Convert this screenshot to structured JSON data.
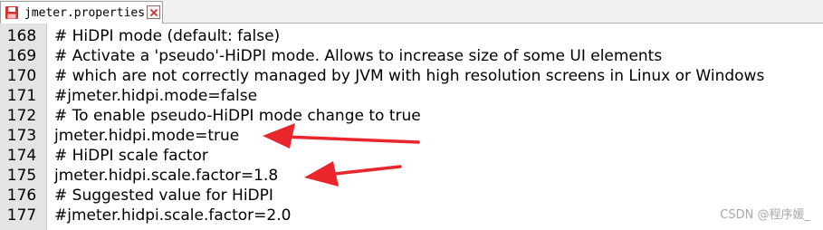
{
  "tab": {
    "title": "jmeter.properties",
    "icon": "save-file-icon",
    "close_icon": "close-icon"
  },
  "lines": [
    {
      "number": "168",
      "text": "# HiDPI mode (default: false)"
    },
    {
      "number": "169",
      "text": "# Activate a 'pseudo'-HiDPI mode. Allows to increase size of some UI elements"
    },
    {
      "number": "170",
      "text": "# which are not correctly managed by JVM with high resolution screens in Linux or Windows"
    },
    {
      "number": "171",
      "text": "#jmeter.hidpi.mode=false"
    },
    {
      "number": "172",
      "text": "# To enable pseudo-HiDPI mode change to true"
    },
    {
      "number": "173",
      "text": "jmeter.hidpi.mode=true"
    },
    {
      "number": "174",
      "text": "# HiDPI scale factor"
    },
    {
      "number": "175",
      "text": "jmeter.hidpi.scale.factor=1.8"
    },
    {
      "number": "176",
      "text": "# Suggested value for HiDPI"
    },
    {
      "number": "177",
      "text": "#jmeter.hidpi.scale.factor=2.0"
    }
  ],
  "watermark": "CSDN @程序媛_",
  "colors": {
    "arrow": "#e8262c",
    "gutter": "#e4e4e4",
    "tab_icon": "#d9302c"
  }
}
